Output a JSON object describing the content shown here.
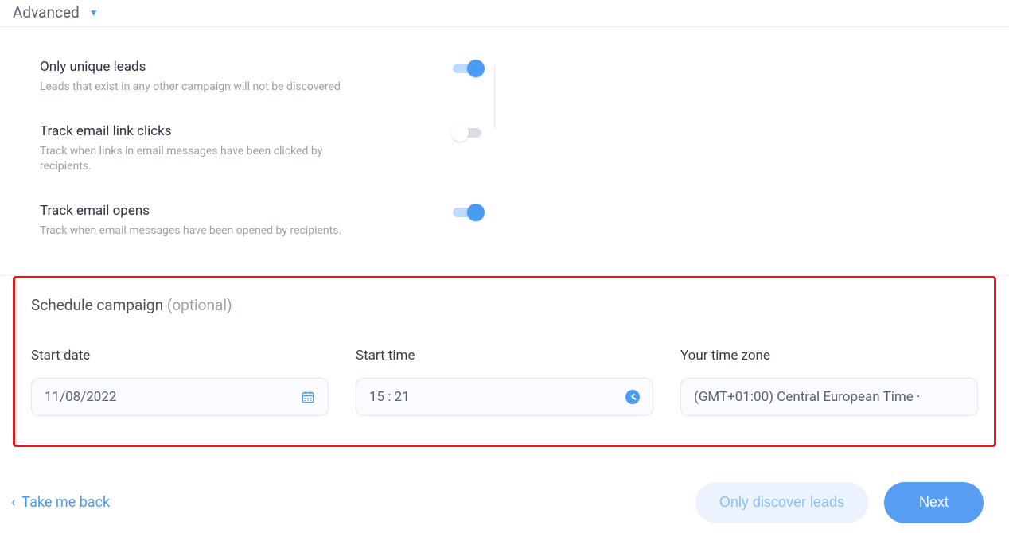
{
  "header": {
    "title": "Advanced"
  },
  "settings": {
    "unique": {
      "title": "Only unique leads",
      "desc": "Leads that exist in any other campaign will not be discovered",
      "on": true
    },
    "clicks": {
      "title": "Track email link clicks",
      "desc": "Track when links in email messages have been clicked by recipients.",
      "on": false
    },
    "opens": {
      "title": "Track email opens",
      "desc": "Track when email messages have been opened by recipients.",
      "on": true
    }
  },
  "schedule": {
    "heading": "Schedule campaign",
    "optional": "(optional)",
    "start_date": {
      "label": "Start date",
      "value": "11/08/2022"
    },
    "start_time": {
      "label": "Start time",
      "value": "15 : 21"
    },
    "timezone": {
      "label": "Your time zone",
      "value": "(GMT+01:00) Central European Time ·"
    }
  },
  "footer": {
    "back": "Take me back",
    "discover": "Only discover leads",
    "next": "Next"
  }
}
